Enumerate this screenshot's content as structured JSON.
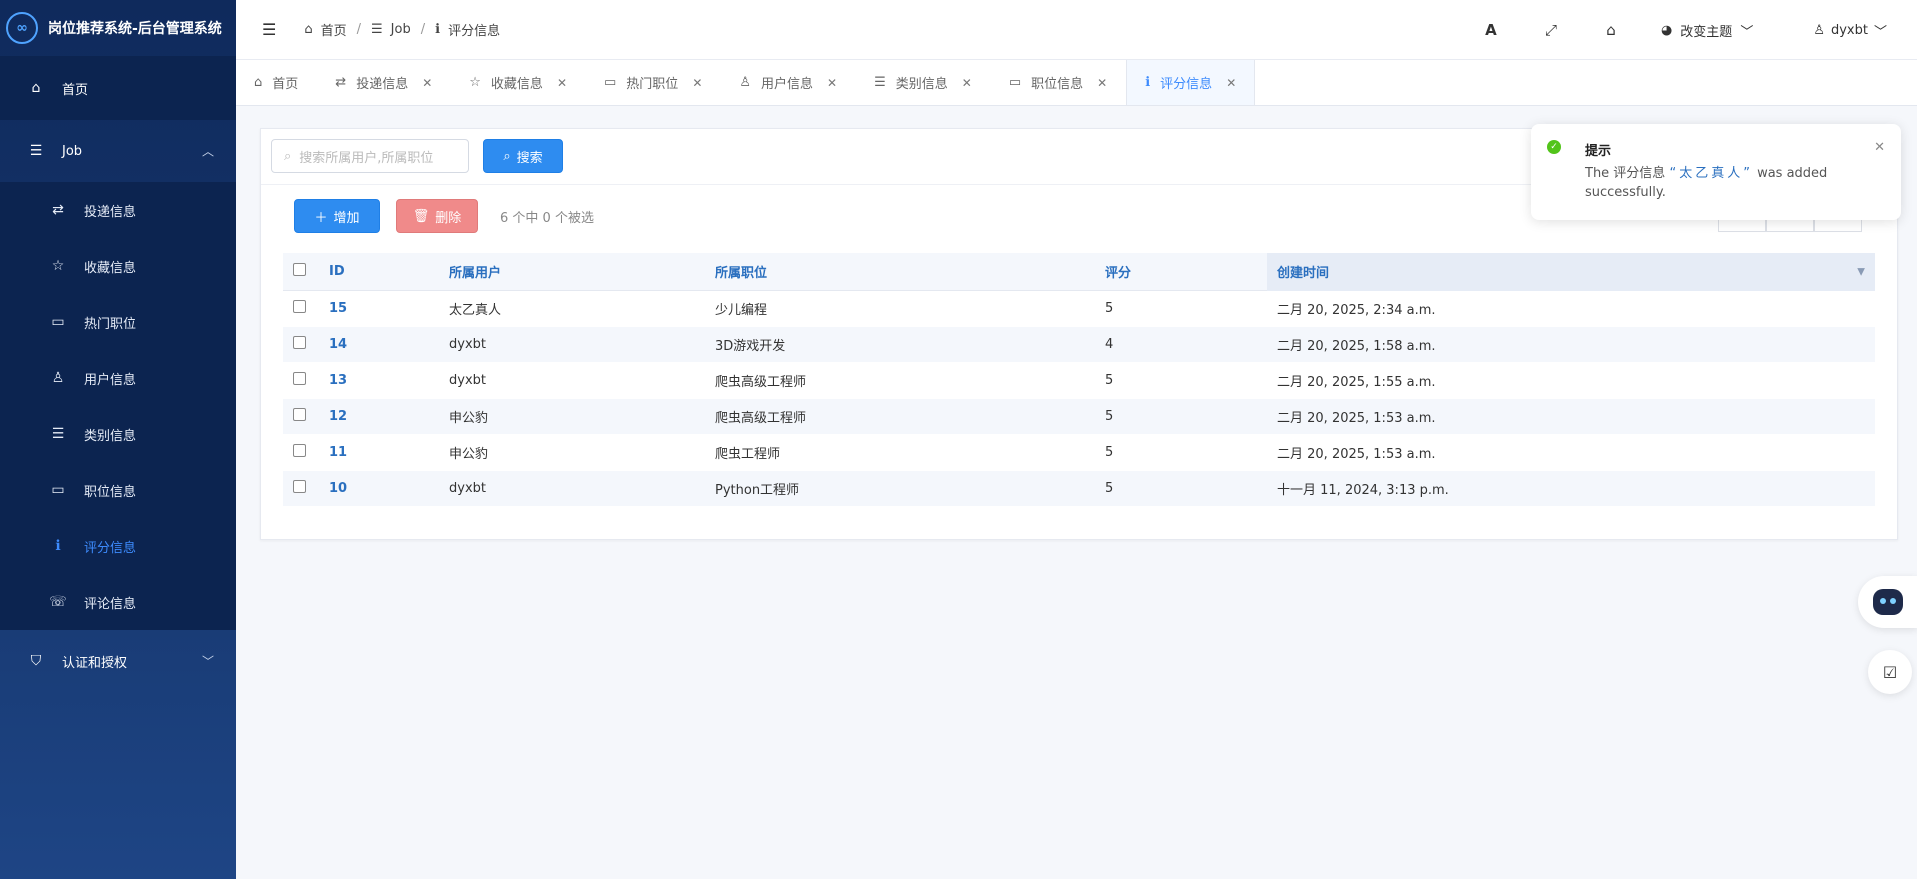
{
  "brand": {
    "title": "岗位推荐系统-后台管理系统",
    "logo": "∞"
  },
  "sidebar": {
    "home": {
      "label": "首页",
      "icon": "home-icon"
    },
    "job_group": {
      "label": "Job",
      "icon": "list-icon"
    },
    "items": [
      {
        "label": "投递信息",
        "icon": "retweet-icon"
      },
      {
        "label": "收藏信息",
        "icon": "star-icon"
      },
      {
        "label": "热门职位",
        "icon": "id-card-icon"
      },
      {
        "label": "用户信息",
        "icon": "user-icon"
      },
      {
        "label": "类别信息",
        "icon": "list-icon"
      },
      {
        "label": "职位信息",
        "icon": "id-card-icon"
      },
      {
        "label": "评分信息",
        "icon": "info-icon",
        "active": true
      },
      {
        "label": "评论信息",
        "icon": "comments-icon"
      }
    ],
    "auth_group": {
      "label": "认证和授权",
      "icon": "shield-icon"
    }
  },
  "header": {
    "breadcrumb": [
      "首页",
      "Job",
      "评分信息"
    ],
    "theme_label": "改变主题",
    "username": "dyxbt"
  },
  "tabs": [
    {
      "label": "首页",
      "closable": false
    },
    {
      "label": "投递信息",
      "closable": true
    },
    {
      "label": "收藏信息",
      "closable": true
    },
    {
      "label": "热门职位",
      "closable": true
    },
    {
      "label": "用户信息",
      "closable": true
    },
    {
      "label": "类别信息",
      "closable": true
    },
    {
      "label": "职位信息",
      "closable": true
    },
    {
      "label": "评分信息",
      "closable": true,
      "active": true
    }
  ],
  "toolbar": {
    "search_placeholder": "搜索所属用户,所属职位",
    "search_label": "搜索",
    "add_label": "增加",
    "delete_label": "删除",
    "selected_info": "6 个中 0 个被选"
  },
  "table": {
    "columns": [
      "ID",
      "所属用户",
      "所属职位",
      "评分",
      "创建时间"
    ],
    "rows": [
      {
        "id": "15",
        "user": "太乙真人",
        "job": "少儿编程",
        "score": "5",
        "time": "二月 20, 2025, 2:34 a.m."
      },
      {
        "id": "14",
        "user": "dyxbt",
        "job": "3D游戏开发",
        "score": "4",
        "time": "二月 20, 2025, 1:58 a.m."
      },
      {
        "id": "13",
        "user": "dyxbt",
        "job": "爬虫高级工程师",
        "score": "5",
        "time": "二月 20, 2025, 1:55 a.m."
      },
      {
        "id": "12",
        "user": "申公豹",
        "job": "爬虫高级工程师",
        "score": "5",
        "time": "二月 20, 2025, 1:53 a.m."
      },
      {
        "id": "11",
        "user": "申公豹",
        "job": "爬虫工程师",
        "score": "5",
        "time": "二月 20, 2025, 1:53 a.m."
      },
      {
        "id": "10",
        "user": "dyxbt",
        "job": "Python工程师",
        "score": "5",
        "time": "十一月 11, 2024, 3:13 p.m."
      }
    ]
  },
  "notice": {
    "title": "提示",
    "prefix": "The 评分信息 ",
    "highlight": "“太乙真人”",
    "suffix": " was added successfully."
  },
  "colors": {
    "accent": "#2e8cf0",
    "sidebar": "#0f2a5c",
    "danger": "#f08a8a",
    "success": "#52c41a"
  }
}
